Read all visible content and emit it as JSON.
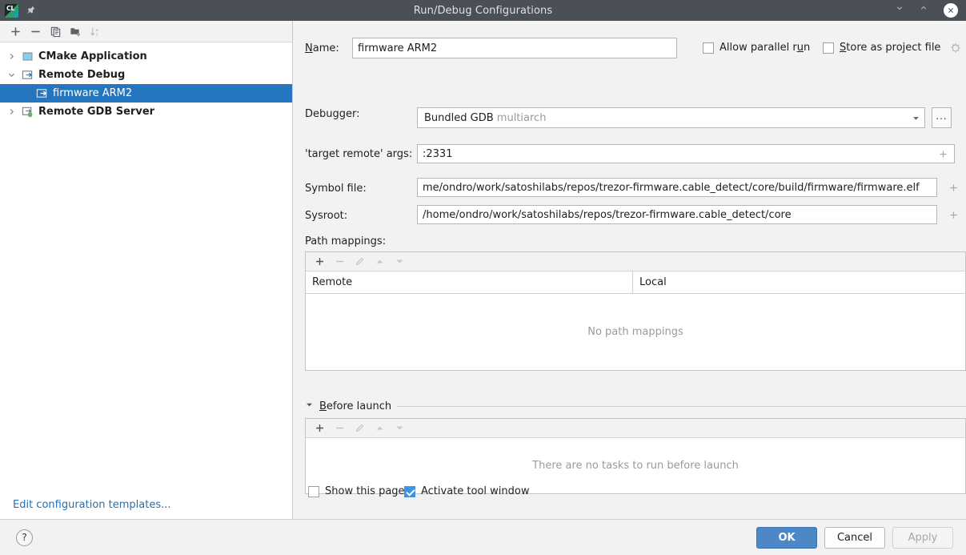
{
  "window": {
    "title": "Run/Debug Configurations",
    "app_icon": "clion-icon",
    "pin_icon": "pin-icon",
    "minimize_label": "",
    "maximize_label": "",
    "close_label": ""
  },
  "left_panel": {
    "toolbar": [
      {
        "name": "add-configuration-button",
        "icon": "plus-icon",
        "label": "+"
      },
      {
        "name": "remove-configuration-button",
        "icon": "minus-icon",
        "label": "−"
      },
      {
        "name": "copy-configuration-button",
        "icon": "copy-icon",
        "label": ""
      },
      {
        "name": "move-into-folder-button",
        "icon": "folder-add-icon",
        "label": ""
      },
      {
        "name": "sort-configurations-button",
        "icon": "sort-az-icon",
        "label": ""
      }
    ],
    "tree": [
      {
        "label": "CMake Application",
        "level": 1,
        "expanded": false,
        "bold": true,
        "selected": false,
        "icon": "cmake-application-icon"
      },
      {
        "label": "Remote Debug",
        "level": 1,
        "expanded": true,
        "bold": true,
        "selected": false,
        "icon": "remote-debug-icon"
      },
      {
        "label": "firmware ARM2",
        "level": 2,
        "expanded": null,
        "bold": false,
        "selected": true,
        "icon": "remote-debug-icon"
      },
      {
        "label": "Remote GDB Server",
        "level": 1,
        "expanded": false,
        "bold": true,
        "selected": false,
        "icon": "remote-gdb-server-icon"
      }
    ],
    "edit_templates_link": "Edit configuration templates..."
  },
  "form": {
    "name_label": "Name:",
    "name_label_mnemonic": "N",
    "name_value": "firmware ARM2",
    "allow_parallel_run_label": "Allow parallel run",
    "allow_parallel_run_checked": false,
    "store_as_project_file_label": "Store as project file",
    "store_as_project_file_checked": false,
    "store_gear_icon": "gear-icon",
    "debugger_label": "Debugger:",
    "debugger_value": "Bundled GDB",
    "debugger_value_suffix": "multiarch",
    "debugger_browse_label": "...",
    "target_remote_args_label": "'target remote' args:",
    "target_remote_args_value": ":2331",
    "symbol_file_label": "Symbol file:",
    "symbol_file_value": "me/ondro/work/satoshilabs/repos/trezor-firmware.cable_detect/core/build/firmware/firmware.elf",
    "sysroot_label": "Sysroot:",
    "sysroot_value": "/home/ondro/work/satoshilabs/repos/trezor-firmware.cable_detect/core",
    "expand_icon": "plus-expand-icon",
    "browse_icon": "folder-browse-icon",
    "path_mappings_label": "Path mappings:",
    "path_mappings_toolbar": [
      {
        "name": "add-path-mapping-button",
        "icon": "plus-icon",
        "enabled": true
      },
      {
        "name": "remove-path-mapping-button",
        "icon": "minus-icon",
        "enabled": false
      },
      {
        "name": "edit-path-mapping-button",
        "icon": "pencil-icon",
        "enabled": false
      },
      {
        "name": "move-up-path-mapping-button",
        "icon": "arrow-up-icon",
        "enabled": false
      },
      {
        "name": "move-down-path-mapping-button",
        "icon": "arrow-down-icon",
        "enabled": false
      }
    ],
    "path_mappings_columns": [
      "Remote",
      "Local"
    ],
    "path_mappings_rows": [],
    "path_mappings_empty_text": "No path mappings",
    "before_launch_label": "Before launch",
    "before_launch_mnemonic": "B",
    "before_launch_expanded": true,
    "before_launch_toolbar": [
      {
        "name": "add-before-launch-task-button",
        "icon": "plus-icon",
        "enabled": true
      },
      {
        "name": "remove-before-launch-task-button",
        "icon": "minus-icon",
        "enabled": false
      },
      {
        "name": "edit-before-launch-task-button",
        "icon": "pencil-icon",
        "enabled": false
      },
      {
        "name": "move-up-before-launch-task-button",
        "icon": "arrow-up-icon",
        "enabled": false
      },
      {
        "name": "move-down-before-launch-task-button",
        "icon": "arrow-down-icon",
        "enabled": false
      }
    ],
    "before_launch_empty_text": "There are no tasks to run before launch",
    "show_this_page_label": "Show this page",
    "show_this_page_checked": false,
    "activate_tool_window_label": "Activate tool window",
    "activate_tool_window_checked": true
  },
  "footer": {
    "help_label": "?",
    "ok_label": "OK",
    "cancel_label": "Cancel",
    "apply_label": "Apply",
    "apply_enabled": false
  },
  "colors": {
    "titlebar": "#4a5055",
    "selection": "#2675bf",
    "accent": "#4d87c7",
    "link": "#2470b3",
    "muted_text": "#9a9a9a"
  }
}
